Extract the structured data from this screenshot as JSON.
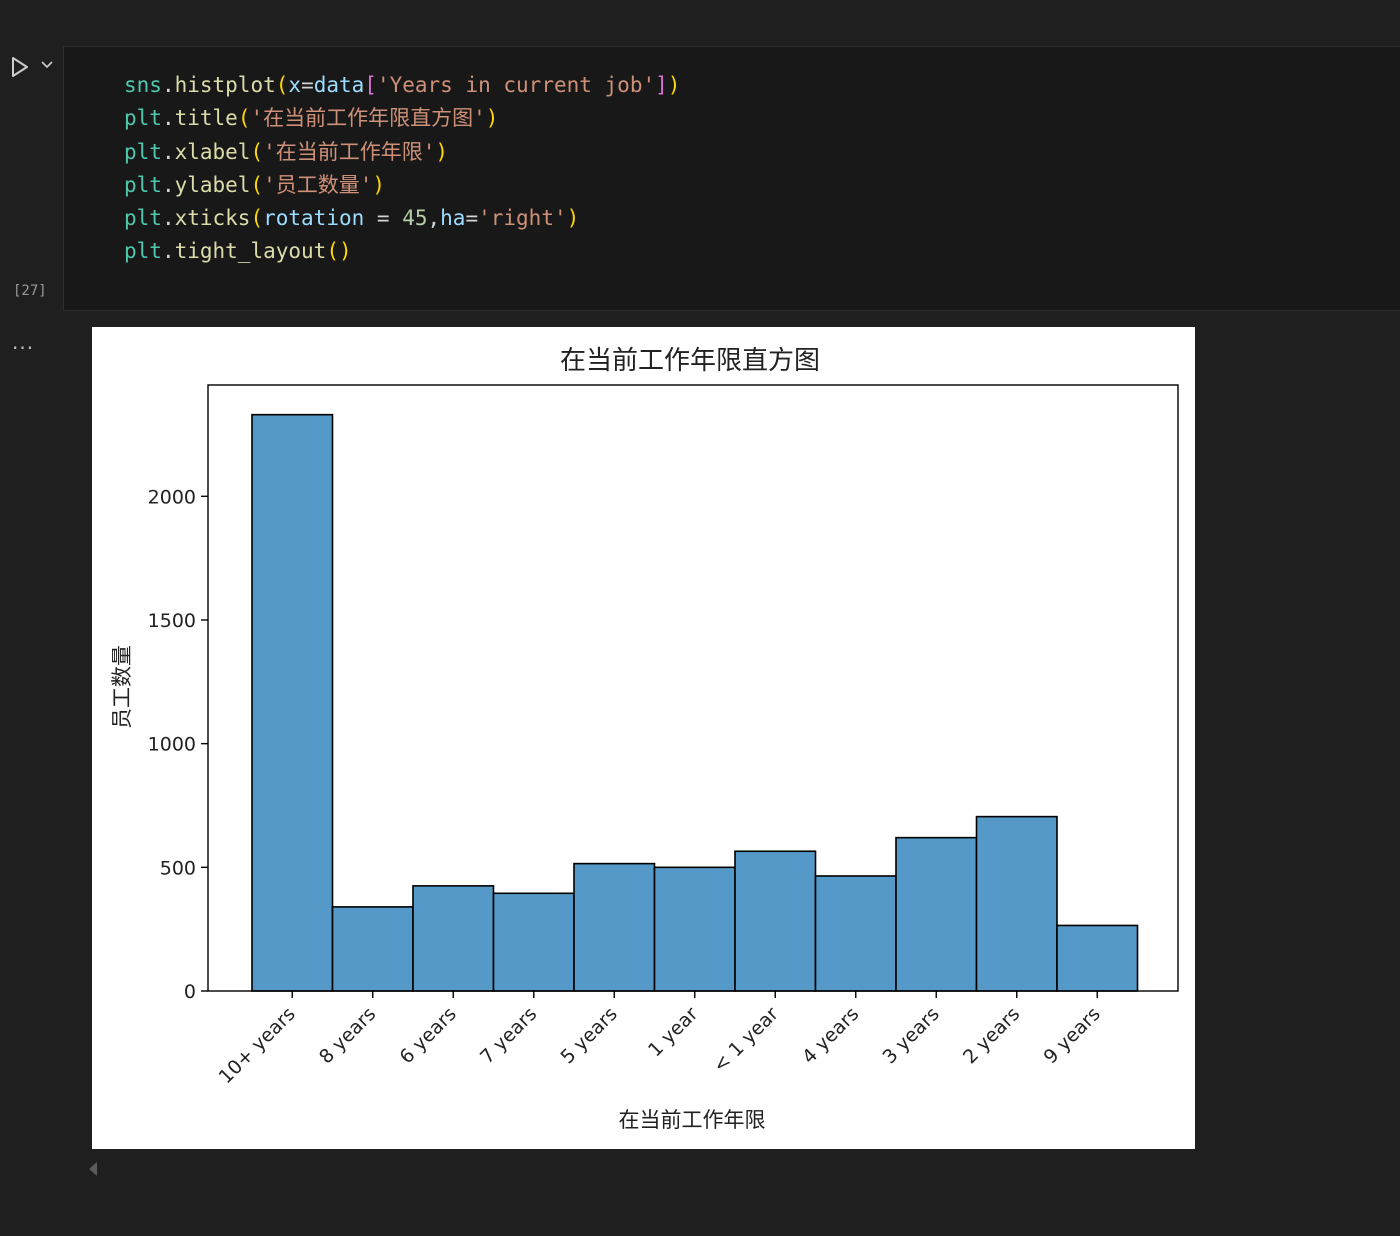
{
  "cell": {
    "execution_count": "[27]",
    "run_icon": "play-icon",
    "more_icon": "chevron-down-icon",
    "output_menu": "..."
  },
  "code_lines": [
    "sns.histplot(x=data['Years in current job'])",
    "plt.title('在当前工作年限直方图')",
    "plt.xlabel('在当前工作年限')",
    "plt.ylabel('员工数量')",
    "plt.xticks(rotation = 45,ha='right')",
    "plt.tight_layout()"
  ],
  "chart_data": {
    "type": "bar",
    "title": "在当前工作年限直方图",
    "xlabel": "在当前工作年限",
    "ylabel": "员工数量",
    "categories": [
      "10+ years",
      "8 years",
      "6 years",
      "7 years",
      "5 years",
      "1 year",
      "< 1 year",
      "4 years",
      "3 years",
      "2 years",
      "9 years"
    ],
    "values": [
      2330,
      340,
      425,
      395,
      515,
      500,
      565,
      465,
      620,
      705,
      265
    ],
    "ylim": [
      0,
      2450
    ],
    "yticks": [
      0,
      500,
      1000,
      1500,
      2000
    ],
    "tick_labels_rotation": "45",
    "grid": false,
    "bar_color": "#5499c7",
    "edge_color": "#000000"
  },
  "colors": {
    "background": "#1f1f1f",
    "cell_background": "#181818"
  }
}
